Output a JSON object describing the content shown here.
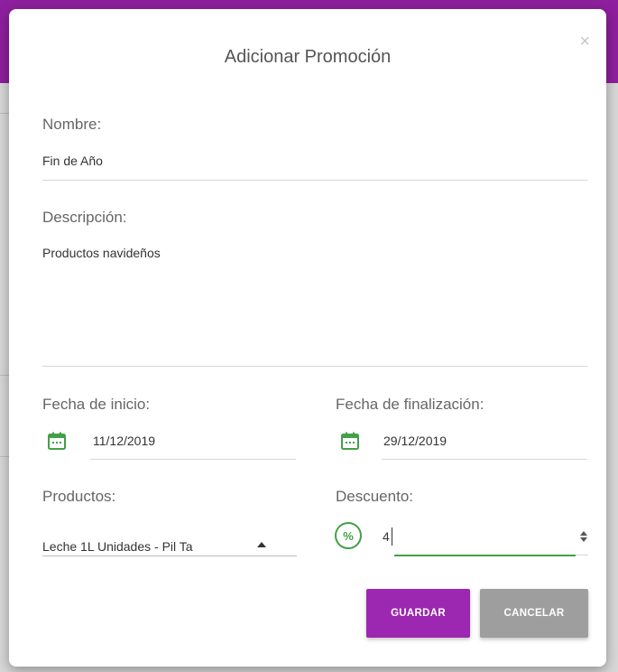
{
  "modal": {
    "title": "Adicionar Promoción",
    "close_glyph": "×"
  },
  "form": {
    "nombre": {
      "label": "Nombre:",
      "value": "Fin de Año"
    },
    "descripcion": {
      "label": "Descripción:",
      "value": "Productos navideños"
    },
    "fecha_inicio": {
      "label": "Fecha de inicio:",
      "value": "11/12/2019",
      "icon": "calendar-icon"
    },
    "fecha_fin": {
      "label": "Fecha de finalización:",
      "value": "29/12/2019",
      "icon": "calendar-icon"
    },
    "productos": {
      "label": "Productos:",
      "selected": "Leche 1L Unidades - Pil Ta"
    },
    "descuento": {
      "label": "Descuento:",
      "value": "4",
      "icon": "percent-icon"
    }
  },
  "buttons": {
    "save": "GUARDAR",
    "cancel": "CANCELAR"
  },
  "colors": {
    "primary": "#9c27b0",
    "secondary": "#9e9e9e",
    "accent_green": "#43a047",
    "header_purple": "#8e1f9e"
  }
}
